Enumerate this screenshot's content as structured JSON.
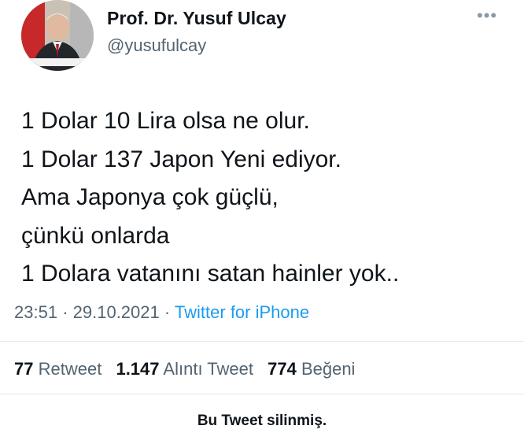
{
  "author": {
    "display_name": "Prof. Dr. Yusuf Ulcay",
    "handle": "@yusufulcay",
    "avatar_icon": "profile-photo"
  },
  "more_icon": "more-horizontal-icon",
  "tweet": {
    "lines": [
      "1 Dolar 10 Lira olsa ne olur.",
      "1 Dolar 137 Japon Yeni ediyor.",
      "Ama Japonya çok güçlü,",
      "çünkü onlarda",
      "1 Dolara vatanını satan hainler yok.."
    ]
  },
  "meta": {
    "time": "23:51",
    "separator": "·",
    "date": "29.10.2021",
    "source": "Twitter for iPhone"
  },
  "stats": {
    "retweets": {
      "count": "77",
      "label": "Retweet"
    },
    "quotes": {
      "count": "1.147",
      "label": "Alıntı Tweet"
    },
    "likes": {
      "count": "774",
      "label": "Beğeni"
    }
  },
  "footer_note": "Bu Tweet silinmiş.",
  "colors": {
    "text": "#0f1419",
    "secondary": "#536471",
    "link": "#1d9bf0",
    "divider": "#e1e6ea"
  }
}
